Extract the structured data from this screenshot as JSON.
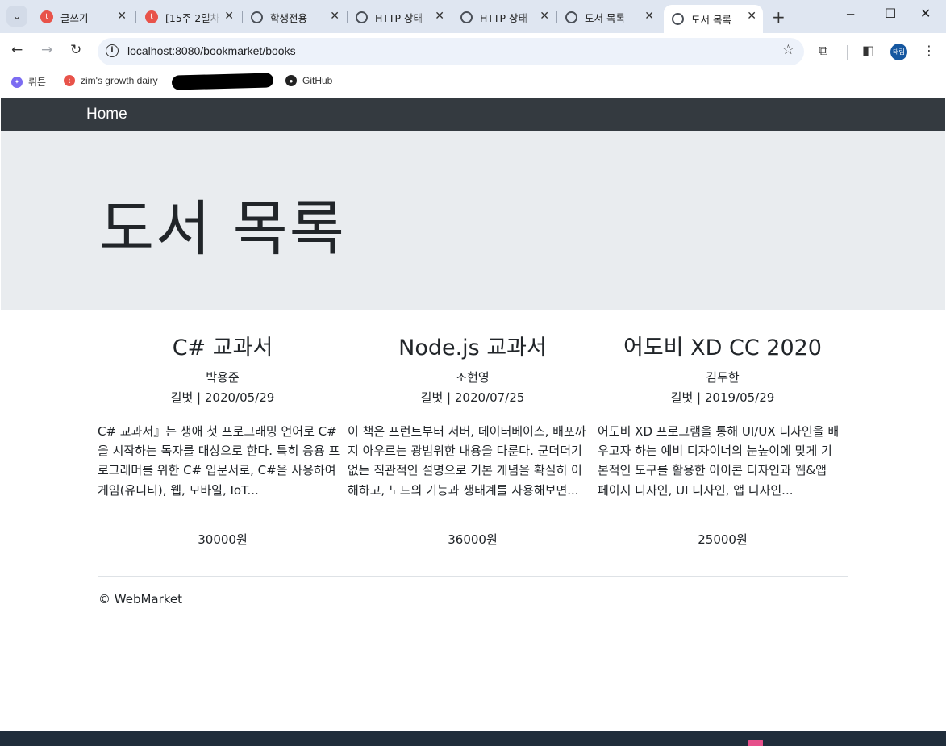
{
  "browser": {
    "tabs": [
      {
        "label": "글쓰기",
        "favicon": "red"
      },
      {
        "label": "[15주 2일차]",
        "favicon": "red"
      },
      {
        "label": "학생전용 -",
        "favicon": "globe"
      },
      {
        "label": "HTTP 상태",
        "favicon": "globe"
      },
      {
        "label": "HTTP 상태",
        "favicon": "globe"
      },
      {
        "label": "도서 목록",
        "favicon": "globe"
      },
      {
        "label": "도서 목록",
        "favicon": "globe",
        "active": true
      }
    ],
    "url": "localhost:8080/bookmarket/books",
    "profile_initials": "태림",
    "bookmarks": [
      {
        "label": "뤼튼",
        "icon": "wrtn-icon",
        "color": "#7c6cf2"
      },
      {
        "label": "zim's growth dairy",
        "icon": "tistory-icon",
        "color": "#e8534a"
      },
      {
        "label": "GitHub",
        "icon": "github-icon",
        "color": "#222222"
      }
    ]
  },
  "navbar": {
    "home_label": "Home"
  },
  "jumbotron": {
    "title": "도서 목록"
  },
  "books": [
    {
      "title": "C# 교과서",
      "author": "박용준",
      "publisher_date": "길벗 | 2020/05/29",
      "description": "C# 교과서』는 생애 첫 프로그래밍 언어로 C#을 시작하는 독자를 대상으로 한다. 특히 응용 프로그래머를 위한 C# 입문서로, C#을 사용하여 게임(유니티), 웹, 모바일, IoT...",
      "price": "30000원"
    },
    {
      "title": "Node.js 교과서",
      "author": "조현영",
      "publisher_date": "길벗 | 2020/07/25",
      "description": "이 책은 프런트부터 서버, 데이터베이스, 배포까지 아우르는 광범위한 내용을 다룬다. 군더더기 없는 직관적인 설명으로 기본 개념을 확실히 이해하고, 노드의 기능과 생태계를 사용해보면...",
      "price": "36000원"
    },
    {
      "title": "어도비 XD CC 2020",
      "author": "김두한",
      "publisher_date": "길벗 | 2019/05/29",
      "description": "어도비 XD 프로그램을 통해 UI/UX 디자인을 배우고자 하는 예비 디자이너의 눈높이에 맞게 기본적인 도구를 활용한 아이콘 디자인과 웹&앱 페이지 디자인, UI 디자인, 앱 디자인...",
      "price": "25000원"
    }
  ],
  "footer": {
    "text": "© WebMarket"
  },
  "colors": {
    "navbar_bg": "#343a40",
    "jumbotron_bg": "#e9ecef",
    "tabstrip_bg": "#dfe6f1",
    "omnibox_bg": "#edf2fa"
  }
}
